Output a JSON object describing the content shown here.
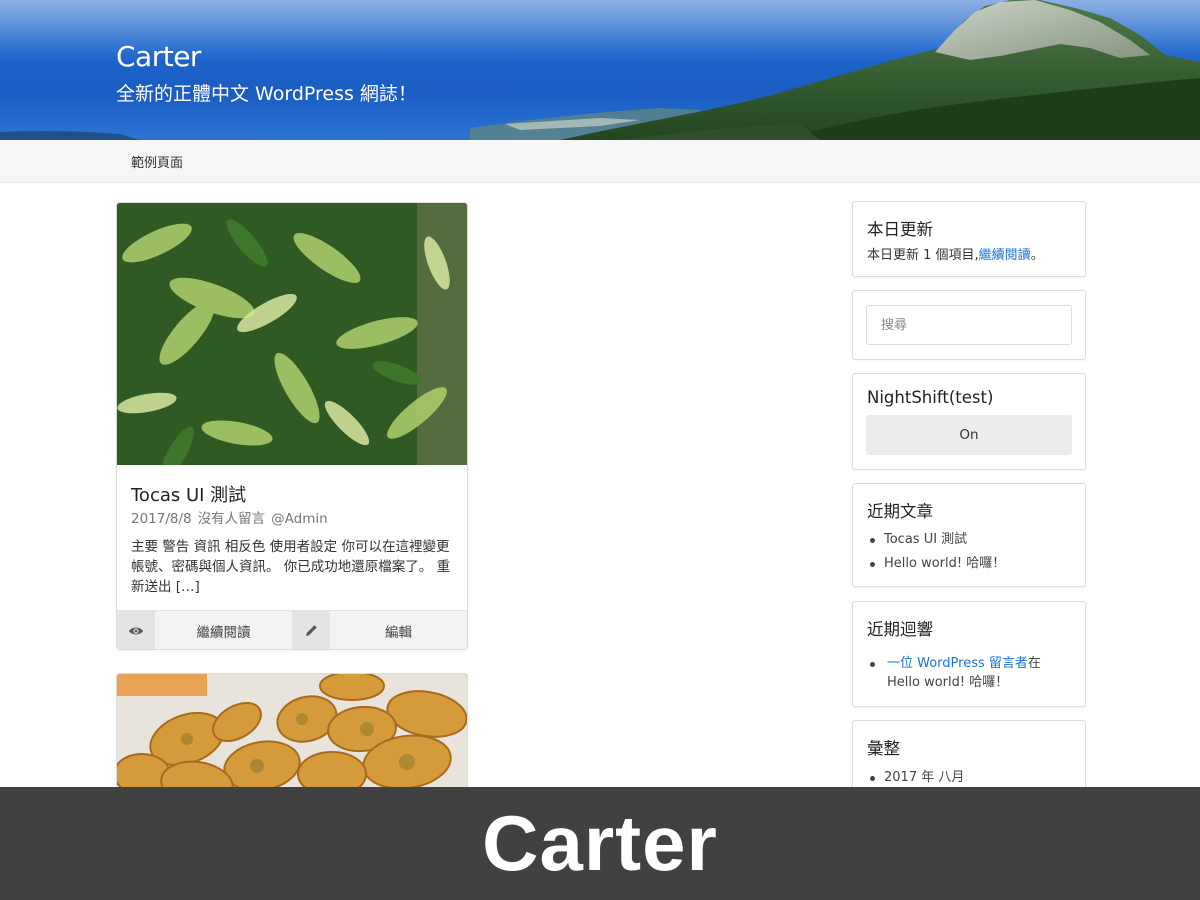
{
  "header": {
    "site_title": "Carter",
    "tagline": "全新的正體中文 WordPress 網誌！"
  },
  "nav": {
    "items": [
      "範例頁面"
    ]
  },
  "posts": [
    {
      "title": "Tocas UI 測試",
      "date": "2017/8/8",
      "comments": "沒有人留言",
      "author": "@Admin",
      "excerpt": "主要 警告 資訊 相反色 使用者設定 你可以在這裡變更帳號、密碼與個人資訊。 你已成功地還原檔案了。 重新送出 […]",
      "actions": {
        "read_more_icon": "eye-icon",
        "read_more": "繼續閱讀",
        "edit_icon": "pencil-icon",
        "edit": "編輯"
      }
    }
  ],
  "sidebar": {
    "today": {
      "title": "本日更新",
      "text_prefix": "本日更新 1 個項目,",
      "link": "繼續閱讀",
      "text_suffix": "。"
    },
    "search": {
      "placeholder": "搜尋"
    },
    "nightshift": {
      "title": "NightShift(test)",
      "button": "On"
    },
    "recent_posts": {
      "title": "近期文章",
      "items": [
        "Tocas UI 測試",
        "Hello world! 哈囉！"
      ]
    },
    "recent_comments": {
      "title": "近期迴響",
      "author_link": "一位 WordPress 留言者",
      "connector": "在",
      "post": "Hello world! 哈囉！"
    },
    "archives": {
      "title": "彙整",
      "items": [
        "2017 年 八月"
      ]
    }
  },
  "banner": {
    "theme_name": "Carter"
  },
  "colors": {
    "link": "#1a73d9",
    "banner_bg": "#414141",
    "nav_bg": "#f6f6f6"
  }
}
